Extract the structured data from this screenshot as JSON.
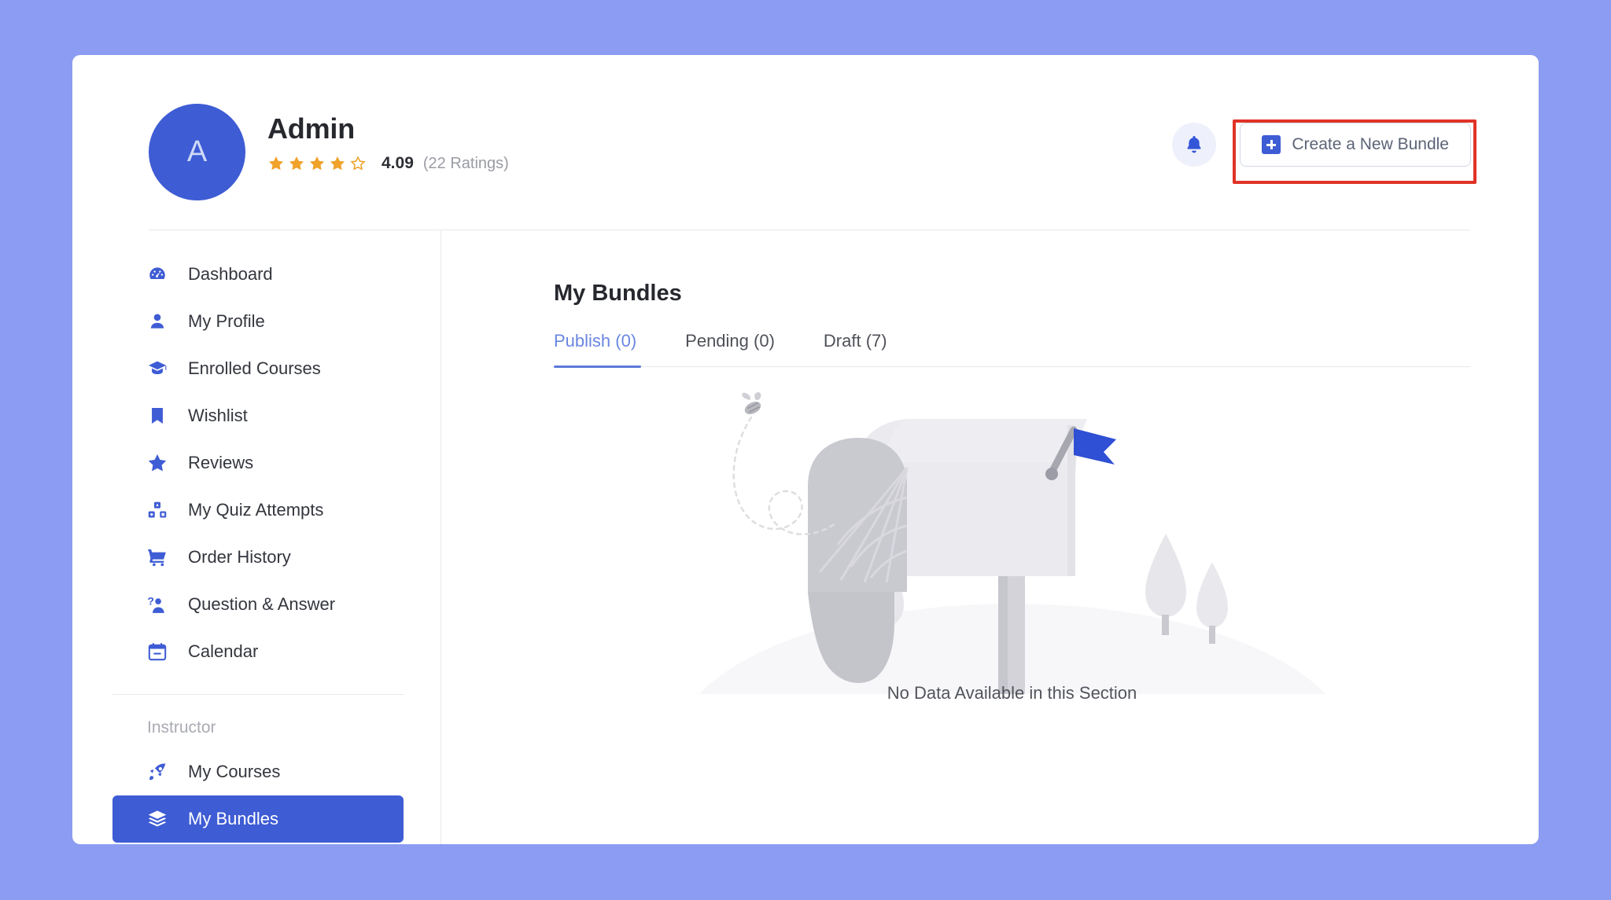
{
  "theme": {
    "page_background": "#8b9cf2",
    "card_background": "#ffffff",
    "accent_blue": "#3e5cd4",
    "tab_active_blue": "#6a86e0",
    "star_orange": "#f0a22b",
    "annotation_red": "#e03326",
    "muted_text": "#9a9ca3"
  },
  "header": {
    "avatar_initial": "A",
    "user_name": "Admin",
    "rating": {
      "value": "4.09",
      "count_label": "(22 Ratings)",
      "filled_stars": 4,
      "total_stars": 5
    },
    "notification_icon": "bell-icon",
    "create_button": {
      "label": "Create a New Bundle",
      "icon": "plus-square-icon"
    }
  },
  "sidebar": {
    "items": [
      {
        "label": "Dashboard",
        "icon": "dashboard-gauge-icon",
        "active": false
      },
      {
        "label": "My Profile",
        "icon": "user-icon",
        "active": false
      },
      {
        "label": "Enrolled Courses",
        "icon": "graduation-cap-icon",
        "active": false
      },
      {
        "label": "Wishlist",
        "icon": "bookmark-icon",
        "active": false
      },
      {
        "label": "Reviews",
        "icon": "star-icon",
        "active": false
      },
      {
        "label": "My Quiz Attempts",
        "icon": "quiz-blocks-icon",
        "active": false
      },
      {
        "label": "Order History",
        "icon": "shopping-cart-icon",
        "active": false
      },
      {
        "label": "Question & Answer",
        "icon": "question-answer-icon",
        "active": false
      },
      {
        "label": "Calendar",
        "icon": "calendar-icon",
        "active": false
      }
    ],
    "section_label": "Instructor",
    "instructor_items": [
      {
        "label": "My Courses",
        "icon": "rocket-icon",
        "active": false
      },
      {
        "label": "My Bundles",
        "icon": "layers-icon",
        "active": true
      }
    ]
  },
  "main": {
    "title": "My Bundles",
    "tabs": [
      {
        "label": "Publish (0)",
        "active": true
      },
      {
        "label": "Pending (0)",
        "active": false
      },
      {
        "label": "Draft (7)",
        "active": false
      }
    ],
    "empty_state": {
      "message": "No Data Available in this Section",
      "illustration": "mailbox-empty-illustration"
    }
  }
}
